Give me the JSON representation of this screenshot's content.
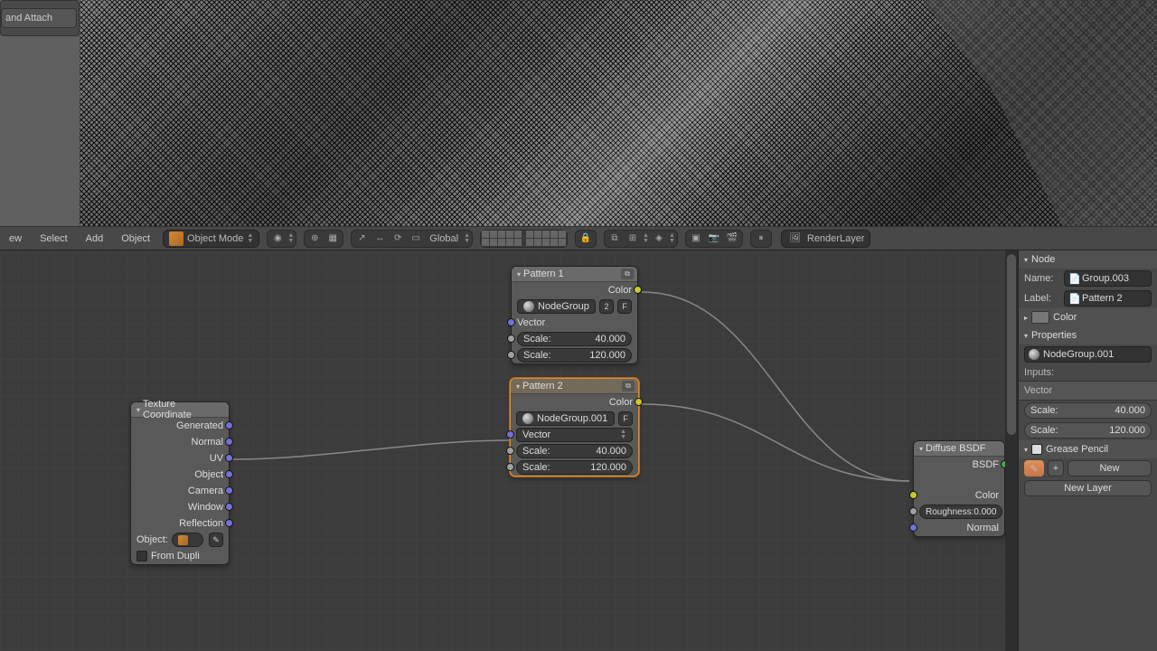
{
  "toolpanel": {
    "button": "and Attach"
  },
  "header": {
    "menus": [
      "ew",
      "Select",
      "Add",
      "Object"
    ],
    "mode": "Object Mode",
    "orient": "Global",
    "render_layer": "RenderLayer"
  },
  "nodes": {
    "texcoord": {
      "title": "Texture Coordinate",
      "outputs": [
        "Generated",
        "Normal",
        "UV",
        "Object",
        "Camera",
        "Window",
        "Reflection"
      ],
      "object_label": "Object:",
      "from_dupli": "From Dupli"
    },
    "pattern1": {
      "title": "Pattern 1",
      "out_color": "Color",
      "group": "NodeGroup",
      "users": "2",
      "f": "F",
      "vector": "Vector",
      "scale1_label": "Scale:",
      "scale1": "40.000",
      "scale2_label": "Scale:",
      "scale2": "120.000"
    },
    "pattern2": {
      "title": "Pattern 2",
      "out_color": "Color",
      "group": "NodeGroup.001",
      "f": "F",
      "vector": "Vector",
      "scale1_label": "Scale:",
      "scale1": "40.000",
      "scale2_label": "Scale:",
      "scale2": "120.000"
    },
    "diffuse": {
      "title": "Diffuse BSDF",
      "out_bsdf": "BSDF",
      "color": "Color",
      "roughness_label": "Roughness:",
      "roughness": "0.000",
      "normal": "Normal"
    }
  },
  "panel": {
    "node_hdr": "Node",
    "name_label": "Name:",
    "name_value": "Group.003",
    "label_label": "Label:",
    "label_value": "Pattern 2",
    "color_hdr": "Color",
    "properties_hdr": "Properties",
    "group_value": "NodeGroup.001",
    "inputs_label": "Inputs:",
    "input_vector": "Vector",
    "scale1_label": "Scale:",
    "scale1_value": "40.000",
    "scale2_label": "Scale:",
    "scale2_value": "120.000",
    "gp_hdr": "Grease Pencil",
    "new": "New",
    "new_layer": "New Layer"
  }
}
